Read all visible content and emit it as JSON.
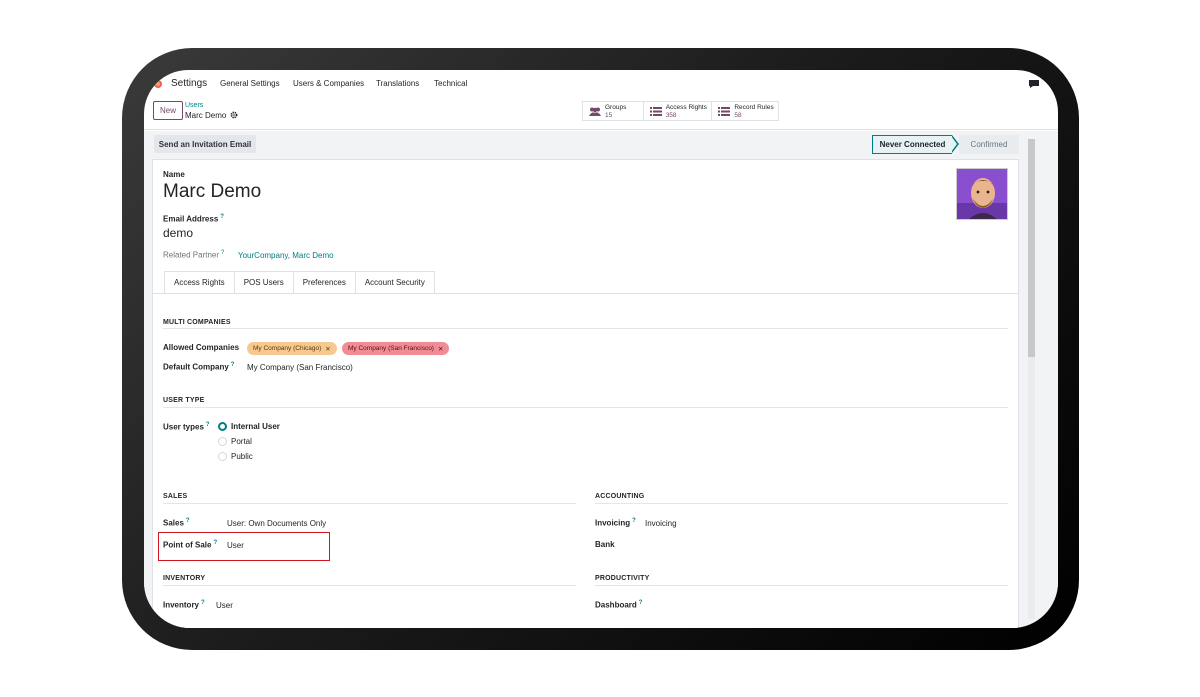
{
  "topnav": {
    "app_title": "Settings",
    "menu": [
      "General Settings",
      "Users & Companies",
      "Translations",
      "Technical"
    ]
  },
  "control_panel": {
    "new_label": "New",
    "breadcrumb_parent": "Users",
    "breadcrumb_current": "Marc Demo",
    "stats": [
      {
        "label": "Groups",
        "value": "15",
        "icon": "users-icon"
      },
      {
        "label": "Access Rights",
        "value": "358",
        "icon": "list-icon"
      },
      {
        "label": "Record Rules",
        "value": "58",
        "icon": "list-icon"
      }
    ]
  },
  "statusbar": {
    "invite_label": "Send an Invitation Email",
    "stages": [
      "Never Connected",
      "Confirmed"
    ],
    "active_stage": "Never Connected"
  },
  "form": {
    "name_label": "Name",
    "name_value": "Marc Demo",
    "email_label": "Email Address",
    "email_help": "?",
    "email_value": "demo",
    "partner_label": "Related Partner",
    "partner_help": "?",
    "partner_value": "YourCompany, Marc Demo",
    "tabs": [
      "Access Rights",
      "POS Users",
      "Preferences",
      "Account Security"
    ],
    "active_tab": "Access Rights",
    "multi_companies": {
      "title": "MULTI COMPANIES",
      "allowed_label": "Allowed Companies",
      "allowed_tags": [
        "My Company (Chicago)",
        "My Company (San Francisco)"
      ],
      "tag_colors": [
        "#f6c991",
        "#f08c95"
      ],
      "default_label": "Default Company",
      "default_help": "?",
      "default_value": "My Company (San Francisco)"
    },
    "user_type": {
      "title": "USER TYPE",
      "label": "User types",
      "help": "?",
      "options": [
        "Internal User",
        "Portal",
        "Public"
      ],
      "selected": "Internal User"
    },
    "sales": {
      "title": "SALES",
      "sales_label": "Sales",
      "sales_help": "?",
      "sales_value": "User: Own Documents Only",
      "pos_label": "Point of Sale",
      "pos_help": "?",
      "pos_value": "User"
    },
    "accounting": {
      "title": "ACCOUNTING",
      "invoicing_label": "Invoicing",
      "invoicing_help": "?",
      "invoicing_value": "Invoicing",
      "bank_label": "Bank"
    },
    "inventory": {
      "title": "INVENTORY",
      "inventory_label": "Inventory",
      "inventory_help": "?",
      "inventory_value": "User"
    },
    "productivity": {
      "title": "PRODUCTIVITY",
      "dashboard_label": "Dashboard",
      "dashboard_help": "?"
    }
  },
  "colors": {
    "brand": "#714B67",
    "accent": "#017e84",
    "highlight": "#d0141e"
  }
}
